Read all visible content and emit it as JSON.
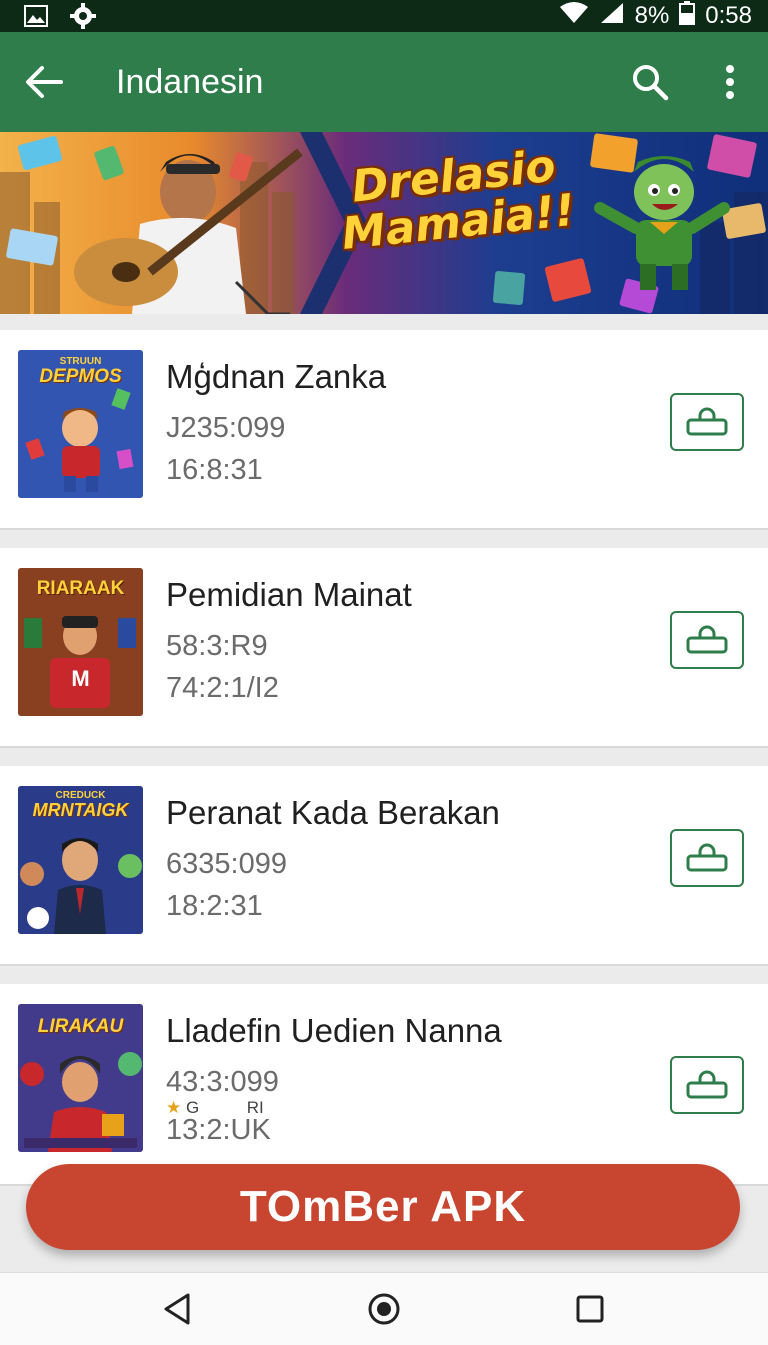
{
  "status_bar": {
    "battery_text": "8%",
    "time": "0:58",
    "icons": [
      "image-icon",
      "settings-gear-icon",
      "wifi-icon",
      "signal-icon",
      "battery-icon"
    ]
  },
  "app_bar": {
    "title": "Indanesin",
    "icons": [
      "back-arrow-icon",
      "search-icon",
      "more-vert-icon"
    ],
    "color": "#2e7d4a"
  },
  "banner": {
    "title": "Drelasio Mamaia!!"
  },
  "items": [
    {
      "title": "Mģdnan Zanka",
      "line1": "J235:099",
      "line2": "16:8:31",
      "thumb_text": "DEPMOS",
      "thumb_top_text": "STRUUN"
    },
    {
      "title": "Pemidian Mainat",
      "line1": "58:3:R9",
      "line2": "74:2:1/I2",
      "thumb_text": "RIARAAK",
      "thumb_badge": "M"
    },
    {
      "title": "Peranat Kada Berakan",
      "line1": "6335:099",
      "line2": "18:2:31",
      "thumb_text": "MRNTAIGK",
      "thumb_top_text": "CREDUCK"
    },
    {
      "title": "Lladefin Uedien Nanna",
      "line1": "43:3:099",
      "line2": "13:2:UK",
      "thumb_text": "LIRAKAU",
      "rating_star": "★",
      "rating_left": "G",
      "rating_right": "RI"
    }
  ],
  "cta": {
    "label": "TOmBer APK",
    "color": "#c8452f"
  },
  "nav_bar": {
    "icons": [
      "nav-back-icon",
      "nav-home-icon",
      "nav-recents-icon"
    ]
  }
}
